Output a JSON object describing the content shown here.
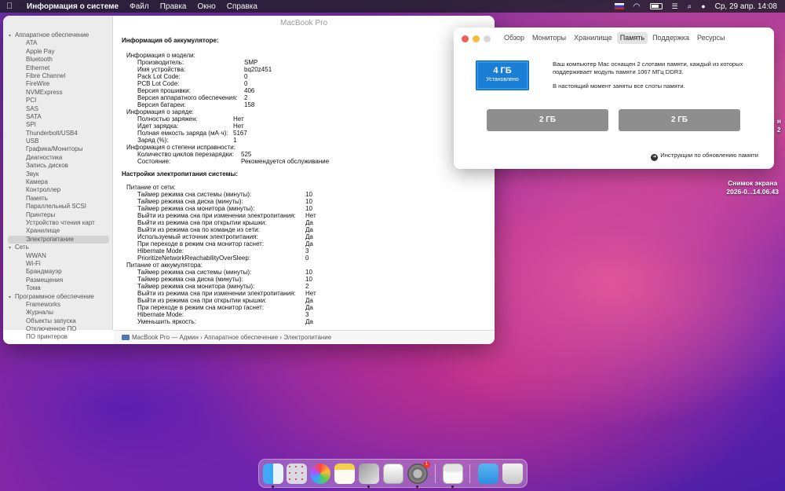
{
  "menubar": {
    "apple": "",
    "app_name": "Информация о системе",
    "menus": [
      "Файл",
      "Правка",
      "Окно",
      "Справка"
    ],
    "datetime": "Ср, 29 апр.  14:08"
  },
  "window": {
    "title": "MacBook Pro",
    "sidebar": [
      {
        "label": "Аппаратное обеспечение",
        "type": "group"
      },
      {
        "label": "ATA",
        "type": "item"
      },
      {
        "label": "Apple Pay",
        "type": "item"
      },
      {
        "label": "Bluetooth",
        "type": "item"
      },
      {
        "label": "Ethernet",
        "type": "item"
      },
      {
        "label": "Fibre Channel",
        "type": "item"
      },
      {
        "label": "FireWire",
        "type": "item"
      },
      {
        "label": "NVMExpress",
        "type": "item"
      },
      {
        "label": "PCI",
        "type": "item"
      },
      {
        "label": "SAS",
        "type": "item"
      },
      {
        "label": "SATA",
        "type": "item"
      },
      {
        "label": "SPI",
        "type": "item"
      },
      {
        "label": "Thunderbolt/USB4",
        "type": "item"
      },
      {
        "label": "USB",
        "type": "item"
      },
      {
        "label": "Графика/Мониторы",
        "type": "item"
      },
      {
        "label": "Диагностика",
        "type": "item"
      },
      {
        "label": "Запись дисков",
        "type": "item"
      },
      {
        "label": "Звук",
        "type": "item"
      },
      {
        "label": "Камера",
        "type": "item"
      },
      {
        "label": "Контроллер",
        "type": "item"
      },
      {
        "label": "Память",
        "type": "item"
      },
      {
        "label": "Параллельный SCSI",
        "type": "item"
      },
      {
        "label": "Принтеры",
        "type": "item"
      },
      {
        "label": "Устройство чтения карт",
        "type": "item"
      },
      {
        "label": "Хранилище",
        "type": "item"
      },
      {
        "label": "Электропитание",
        "type": "item",
        "selected": true
      },
      {
        "label": "Сеть",
        "type": "group"
      },
      {
        "label": "WWAN",
        "type": "item"
      },
      {
        "label": "Wi-Fi",
        "type": "item"
      },
      {
        "label": "Брандмауэр",
        "type": "item"
      },
      {
        "label": "Размещения",
        "type": "item"
      },
      {
        "label": "Тома",
        "type": "item"
      },
      {
        "label": "Программное обеспечение",
        "type": "group"
      },
      {
        "label": "Frameworks",
        "type": "item"
      },
      {
        "label": "Журналы",
        "type": "item"
      },
      {
        "label": "Объекты запуска",
        "type": "item"
      },
      {
        "label": "Отключенное ПО",
        "type": "item"
      },
      {
        "label": "ПО принтеров",
        "type": "item"
      }
    ],
    "battery_title": "Информация об аккумуляторе:",
    "battery_rows": [
      {
        "k": "Информация о модели:",
        "v": "",
        "indent": 1
      },
      {
        "k": "Производитель:",
        "v": "SMP",
        "indent": 2,
        "col": "a"
      },
      {
        "k": "Имя устройства:",
        "v": "bq20z451",
        "indent": 2,
        "col": "a"
      },
      {
        "k": "Pack Lot Code:",
        "v": "0",
        "indent": 2,
        "col": "a"
      },
      {
        "k": "PCB Lot Code:",
        "v": "0",
        "indent": 2,
        "col": "a"
      },
      {
        "k": "Версия прошивки:",
        "v": "406",
        "indent": 2,
        "col": "a"
      },
      {
        "k": "Версия аппаратного обеспечения:",
        "v": "2",
        "indent": 2,
        "col": "a"
      },
      {
        "k": "Версия батареи:",
        "v": "158",
        "indent": 2,
        "col": "a"
      },
      {
        "k": "Информация о заряде:",
        "v": "",
        "indent": 1
      },
      {
        "k": "Полностью заряжен:",
        "v": "Нет",
        "indent": 2,
        "col": "b"
      },
      {
        "k": "Идет зарядка:",
        "v": "Нет",
        "indent": 2,
        "col": "b"
      },
      {
        "k": "Полная емкость заряда (мА·ч):",
        "v": "5167",
        "indent": 2,
        "col": "b"
      },
      {
        "k": "Заряд (%):",
        "v": "1",
        "indent": 2,
        "col": "b"
      },
      {
        "k": "Информация о степени исправности:",
        "v": "",
        "indent": 1
      },
      {
        "k": "Количество циклов перезарядки:",
        "v": "525",
        "indent": 2,
        "col": "c"
      },
      {
        "k": "Состояние:",
        "v": "Рекомендуется обслуживание",
        "indent": 2,
        "col": "c"
      }
    ],
    "power_title": "Настройки электропитания системы:",
    "power_rows": [
      {
        "k": "Питание от сети:",
        "v": "",
        "indent": 1
      },
      {
        "k": "Таймер режима сна системы (минуты):",
        "v": "10",
        "indent": 2
      },
      {
        "k": "Таймер режима сна диска (минуты):",
        "v": "10",
        "indent": 2
      },
      {
        "k": "Таймер режима сна монитора (минуты):",
        "v": "10",
        "indent": 2
      },
      {
        "k": "Выйти из режима сна при изменении электропитания:",
        "v": "Нет",
        "indent": 2
      },
      {
        "k": "Выйти из режима сна при открытии крышки:",
        "v": "Да",
        "indent": 2
      },
      {
        "k": "Выйти из режима сна по команде из сети:",
        "v": "Да",
        "indent": 2
      },
      {
        "k": "Используемый источник электропитания:",
        "v": "Да",
        "indent": 2
      },
      {
        "k": "При переходе в режим сна монитор гаснет:",
        "v": "Да",
        "indent": 2
      },
      {
        "k": "Hibernate Mode:",
        "v": "3",
        "indent": 2
      },
      {
        "k": "PrioritizeNetworkReachabilityOverSleep:",
        "v": "0",
        "indent": 2
      },
      {
        "k": "Питание от аккумулятора:",
        "v": "",
        "indent": 1
      },
      {
        "k": "Таймер режима сна системы (минуты):",
        "v": "10",
        "indent": 2
      },
      {
        "k": "Таймер режима сна диска (минуты):",
        "v": "10",
        "indent": 2
      },
      {
        "k": "Таймер режима сна монитора (минуты):",
        "v": "2",
        "indent": 2
      },
      {
        "k": "Выйти из режима сна при изменении электропитания:",
        "v": "Нет",
        "indent": 2
      },
      {
        "k": "Выйти из режима сна при открытии крышки:",
        "v": "Да",
        "indent": 2
      },
      {
        "k": "При переходе в режим сна монитор гаснет:",
        "v": "Да",
        "indent": 2
      },
      {
        "k": "Hibernate Mode:",
        "v": "3",
        "indent": 2
      },
      {
        "k": "Уменьшить яркость:",
        "v": "Да",
        "indent": 2
      }
    ],
    "breadcrumb": "MacBook Pro — Админ  ›  Аппаратное обеспечение  ›  Электропитание"
  },
  "memory_window": {
    "tabs": [
      "Обзор",
      "Мониторы",
      "Хранилище",
      "Память",
      "Поддержка",
      "Ресурсы"
    ],
    "active_tab": "Память",
    "badge_size": "4 ГБ",
    "badge_status": "Установлено",
    "desc1": "Ваш компьютер Mac оснащен 2 слотами памяти, каждый из которых поддерживает модуль памяти 1067 МГц DDR3.",
    "desc2": "В настоящий момент заняты все слоты памяти.",
    "slot1": "2 ГБ",
    "slot2": "2 ГБ",
    "link": "Инструкции по обновлению памяти"
  },
  "desktop": {
    "screenshot_line1": "Снимок экрана",
    "screenshot_line2": "2026-0...14.06.43",
    "edge1": "н",
    "edge2": "2"
  },
  "colors": {
    "accent": "#1a7fd4",
    "slot_gray": "#8e8e8e"
  },
  "dock": {
    "icons": [
      "finder-icon",
      "launchpad-icon",
      "photos-icon",
      "notes-icon",
      "system-info-icon",
      "preview-icon",
      "system-settings-icon",
      "printer-icon",
      "downloads-folder-icon",
      "trash-icon"
    ],
    "settings_badge": "1"
  }
}
